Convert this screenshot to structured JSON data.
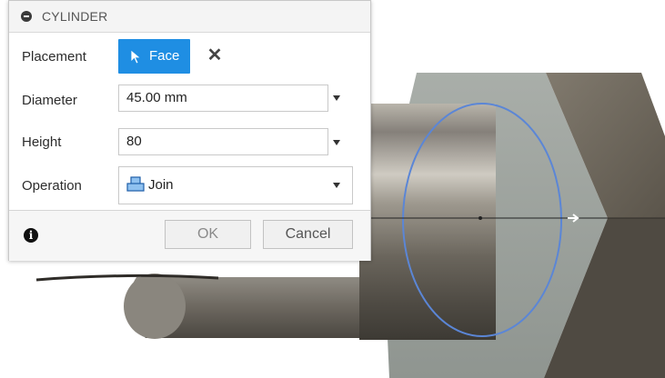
{
  "dialog": {
    "title": "CYLINDER",
    "placement": {
      "label": "Placement",
      "button_label": "Face",
      "clear_icon": "close-icon"
    },
    "diameter": {
      "label": "Diameter",
      "value": "45.00 mm"
    },
    "height": {
      "label": "Height",
      "value": "80"
    },
    "operation": {
      "label": "Operation",
      "value": "Join",
      "icon": "join-icon"
    },
    "footer": {
      "ok_label": "OK",
      "cancel_label": "Cancel",
      "info_icon": "info-icon"
    }
  },
  "colors": {
    "accent": "#1f8ee3",
    "profile_circle": "#5b86d6",
    "model_metal": "#6f6a60"
  }
}
